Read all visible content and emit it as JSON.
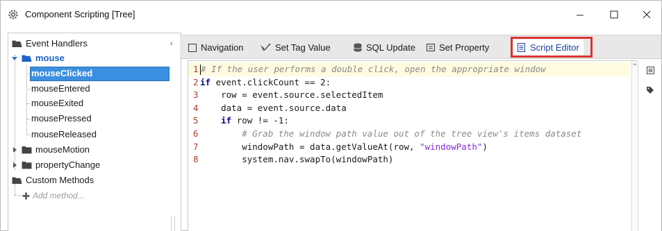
{
  "window": {
    "title": "Component Scripting [Tree]",
    "controls": {
      "minimize": "—",
      "maximize": "☐",
      "close": "✕"
    }
  },
  "tree": {
    "root_event_handlers": "Event Handlers",
    "mouse": "mouse",
    "mouse_children": [
      "mouseClicked",
      "mouseEntered",
      "mouseExited",
      "mousePressed",
      "mouseReleased"
    ],
    "selected": "mouseClicked",
    "mouse_motion": "mouseMotion",
    "property_change": "propertyChange",
    "custom_methods": "Custom Methods",
    "add_method": "Add method..."
  },
  "tabs": [
    {
      "label": "Navigation",
      "icon": "window-icon"
    },
    {
      "label": "Set Tag Value",
      "icon": "tag-wand-icon"
    },
    {
      "label": "SQL Update",
      "icon": "database-icon"
    },
    {
      "label": "Set Property",
      "icon": "property-icon"
    },
    {
      "label": "Script Editor",
      "icon": "script-editor-icon",
      "active": true
    }
  ],
  "editor": {
    "lines": [
      {
        "num": "1",
        "segments": [
          {
            "t": "# If the user performs a double click, open the appropriate window",
            "c": "cmt"
          }
        ]
      },
      {
        "num": "2",
        "segments": [
          {
            "t": "if",
            "c": "kw"
          },
          {
            "t": " event.clickCount == 2:",
            "c": ""
          }
        ]
      },
      {
        "num": "3",
        "segments": [
          {
            "t": "    row = event.source.selectedItem",
            "c": ""
          }
        ]
      },
      {
        "num": "4",
        "segments": [
          {
            "t": "    data = event.source.data",
            "c": ""
          }
        ]
      },
      {
        "num": "5",
        "segments": [
          {
            "t": "    ",
            "c": ""
          },
          {
            "t": "if",
            "c": "kw"
          },
          {
            "t": " row != -1:",
            "c": ""
          }
        ]
      },
      {
        "num": "6",
        "segments": [
          {
            "t": "        # Grab the window path value out of the tree view's items dataset",
            "c": "cmt"
          }
        ]
      },
      {
        "num": "7",
        "segments": [
          {
            "t": "        windowPath = data.getValueAt(row, ",
            "c": ""
          },
          {
            "t": "\"windowPath\"",
            "c": "str"
          },
          {
            "t": ")",
            "c": ""
          }
        ]
      },
      {
        "num": "8",
        "segments": [
          {
            "t": "        system.nav.swapTo(windowPath)",
            "c": ""
          }
        ]
      }
    ]
  },
  "colors": {
    "selection": "#3b8fe0",
    "highlight_box": "#d9342f",
    "active_tab_text": "#1c3f9e",
    "line_numbers": "#b33b2a",
    "comment": "#8a8a8a",
    "keyword": "#0a0a8c",
    "string": "#8a2be2"
  }
}
